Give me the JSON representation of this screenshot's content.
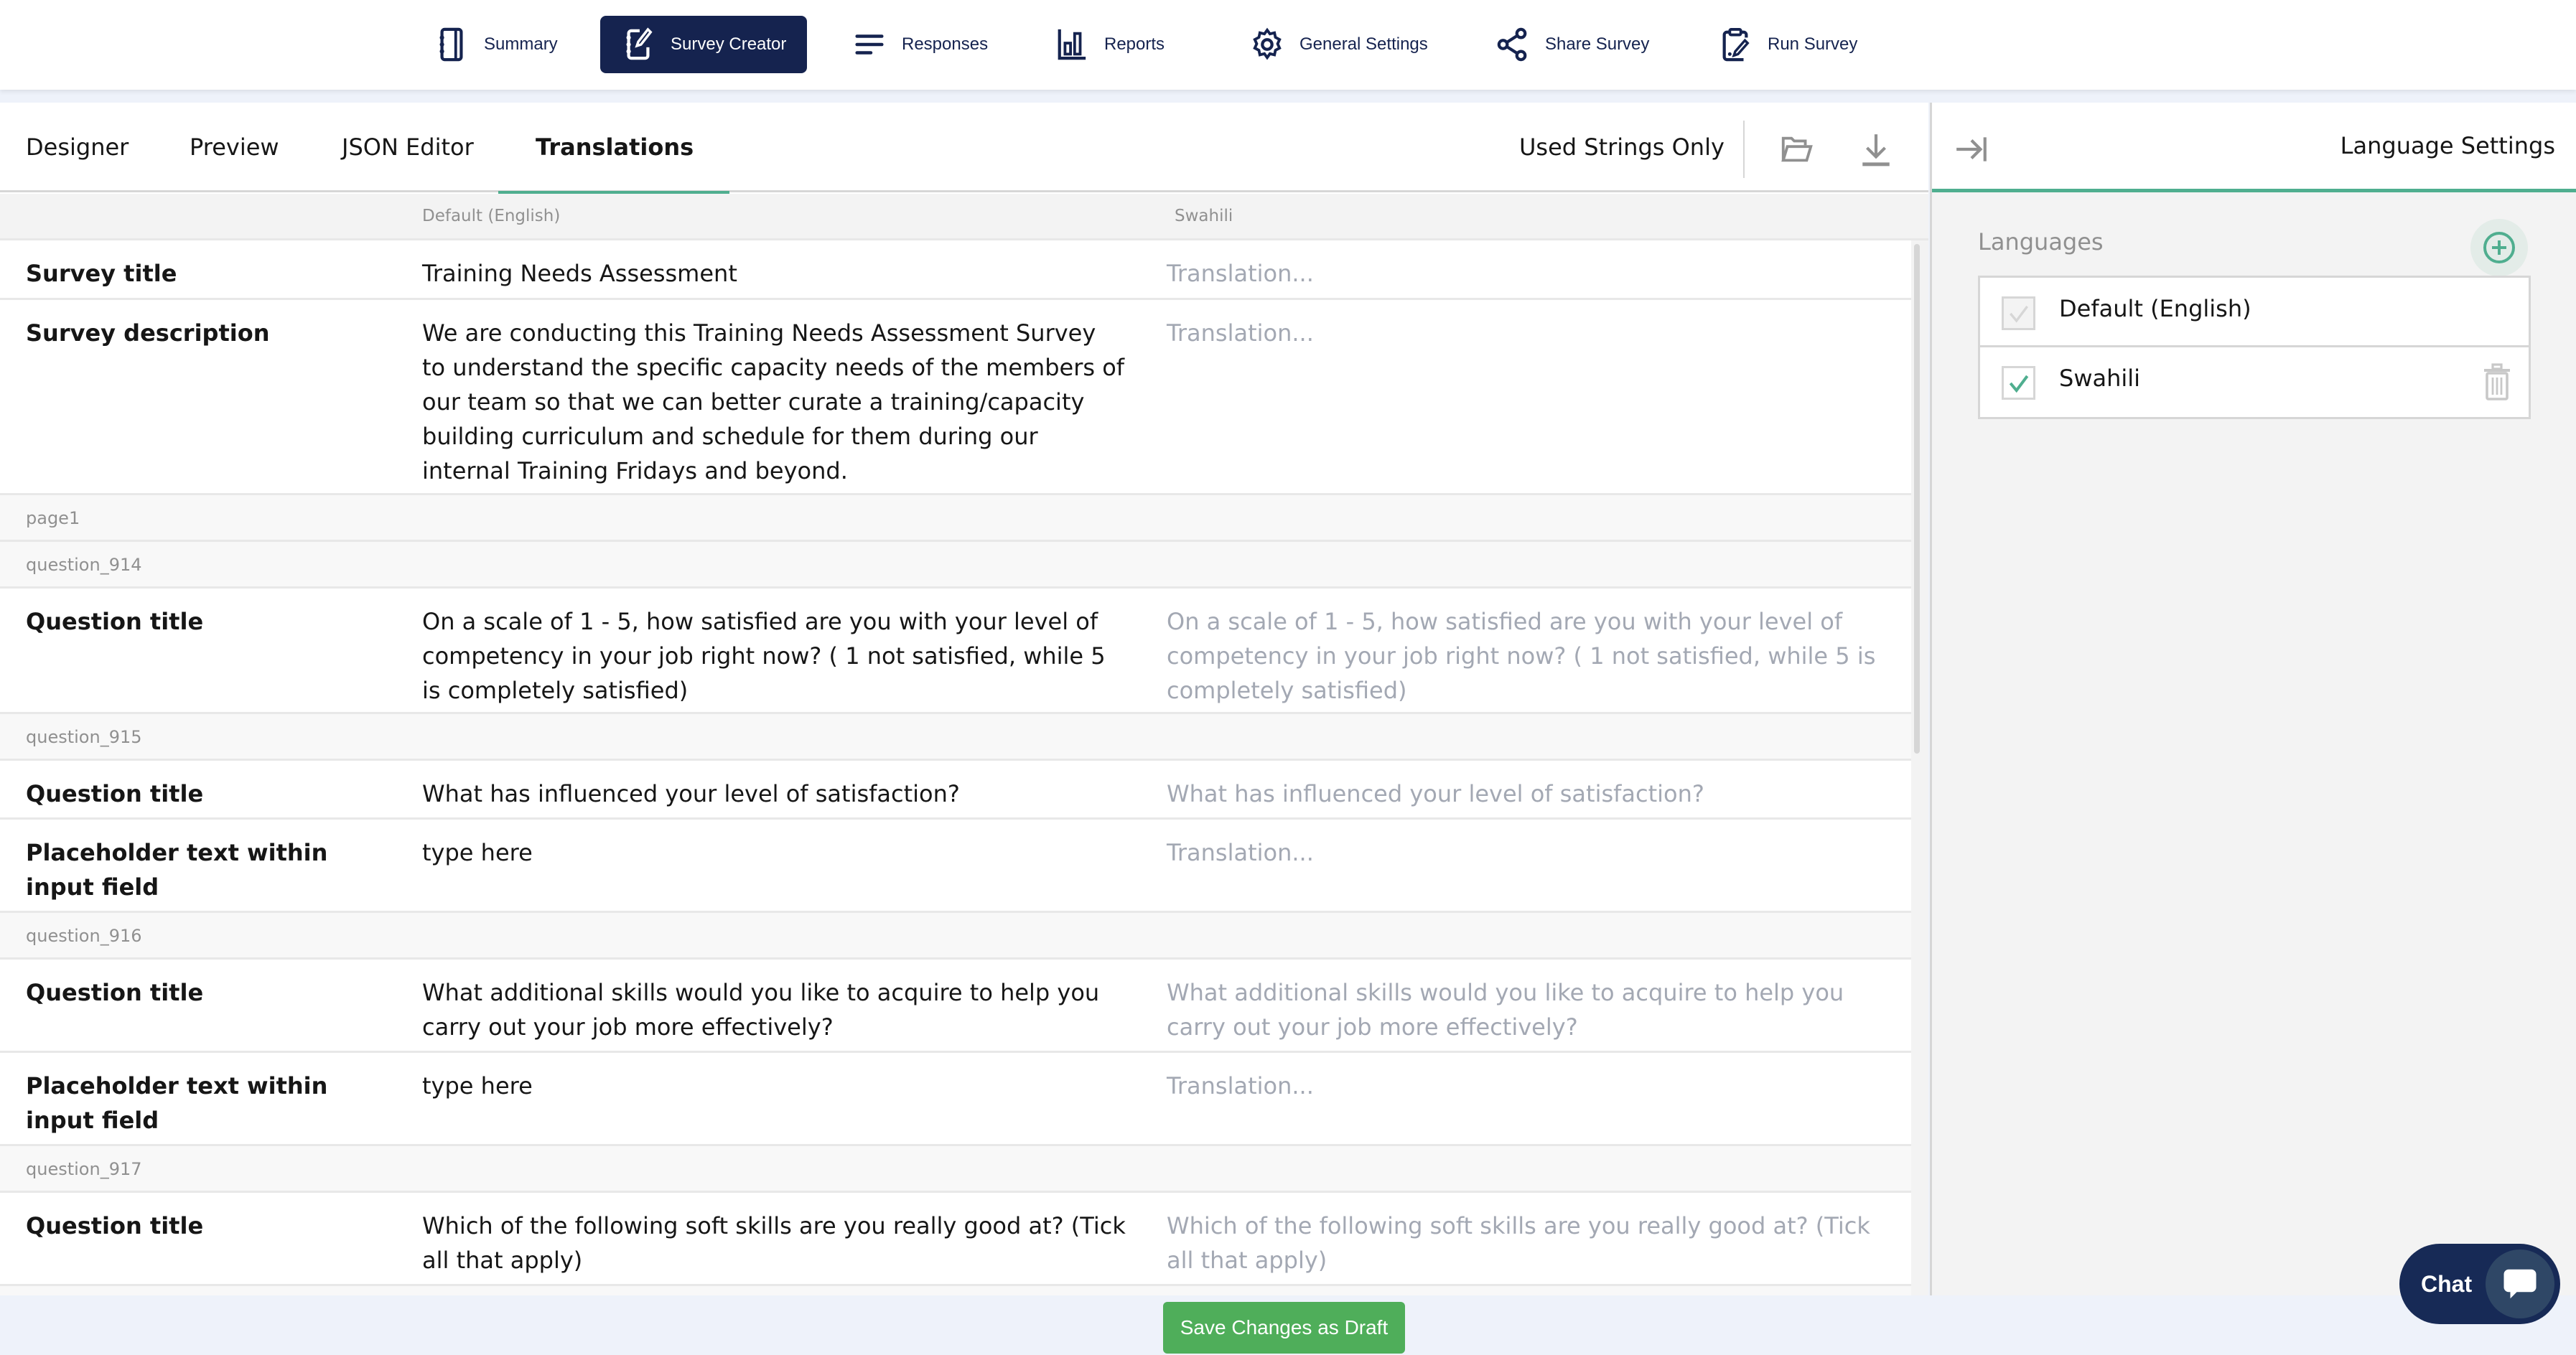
{
  "topnav": {
    "items": [
      {
        "label": "Summary",
        "icon": "notebook-icon",
        "active": false
      },
      {
        "label": "Survey Creator",
        "icon": "notebook-edit-icon",
        "active": true
      },
      {
        "label": "Responses",
        "icon": "lines-icon",
        "active": false
      },
      {
        "label": "Reports",
        "icon": "bar-chart-icon",
        "active": false
      },
      {
        "label": "General Settings",
        "icon": "gear-icon",
        "active": false
      },
      {
        "label": "Share Survey",
        "icon": "share-icon",
        "active": false
      },
      {
        "label": "Run Survey",
        "icon": "clipboard-edit-icon",
        "active": false
      }
    ],
    "accent": "#15234f"
  },
  "tabs": [
    {
      "label": "Designer",
      "active": false
    },
    {
      "label": "Preview",
      "active": false
    },
    {
      "label": "JSON Editor",
      "active": false
    },
    {
      "label": "Translations",
      "active": true
    }
  ],
  "toolbar": {
    "used_strings_only": "Used Strings Only",
    "import_icon": "folder-open-icon",
    "export_icon": "download-icon"
  },
  "table": {
    "columns": [
      "",
      "Default (English)",
      "Swahili"
    ],
    "translation_placeholder": "Translation...",
    "rows": [
      {
        "type": "string",
        "label": "Survey title",
        "default": "Training Needs Assessment",
        "translation": ""
      },
      {
        "type": "string",
        "label": "Survey description",
        "default": "We are conducting this Training Needs Assessment Survey to understand the specific capacity needs of the members of our team so that we can better curate a training/capacity building curriculum and schedule for them during our internal Training Fridays and beyond.",
        "translation": ""
      },
      {
        "type": "group",
        "label": "page1"
      },
      {
        "type": "group",
        "label": "question_914"
      },
      {
        "type": "string",
        "label": "Question title",
        "default": "On a scale of 1 - 5, how satisfied are you with your level of competency in your job right now? ( 1 not satisfied, while 5 is completely satisfied)",
        "translation": "On a scale of 1 - 5, how satisfied are you with your level of competency in your job right now? ( 1 not satisfied, while 5 is completely satisfied)"
      },
      {
        "type": "group",
        "label": "question_915"
      },
      {
        "type": "string",
        "label": "Question title",
        "default": "What has influenced your level of satisfaction?",
        "translation": "What has influenced your level of satisfaction?"
      },
      {
        "type": "string",
        "label": "Placeholder text within input field",
        "default": "type here",
        "translation": ""
      },
      {
        "type": "group",
        "label": "question_916"
      },
      {
        "type": "string",
        "label": "Question title",
        "default": "What additional skills would you like to acquire to help you carry out your job more effectively?",
        "translation": "What additional skills would you like to acquire to help you carry out your job more effectively?"
      },
      {
        "type": "string",
        "label": "Placeholder text within input field",
        "default": "type here",
        "translation": ""
      },
      {
        "type": "group",
        "label": "question_917"
      },
      {
        "type": "string",
        "label": "Question title",
        "default": "Which of the following soft skills are you really good at? (Tick all that apply)",
        "translation": "Which of the following soft skills are you really good at? (Tick all that apply)"
      }
    ]
  },
  "side_panel": {
    "title": "Language Settings",
    "languages_label": "Languages",
    "languages": [
      {
        "name": "Default (English)",
        "checked": true,
        "disabled": true,
        "deletable": false
      },
      {
        "name": "Swahili",
        "checked": true,
        "disabled": false,
        "deletable": true
      }
    ],
    "accent": "#4fae8f"
  },
  "footer": {
    "save_label": "Save Changes as Draft",
    "save_color": "#4fae5a"
  },
  "chat": {
    "label": "Chat"
  }
}
